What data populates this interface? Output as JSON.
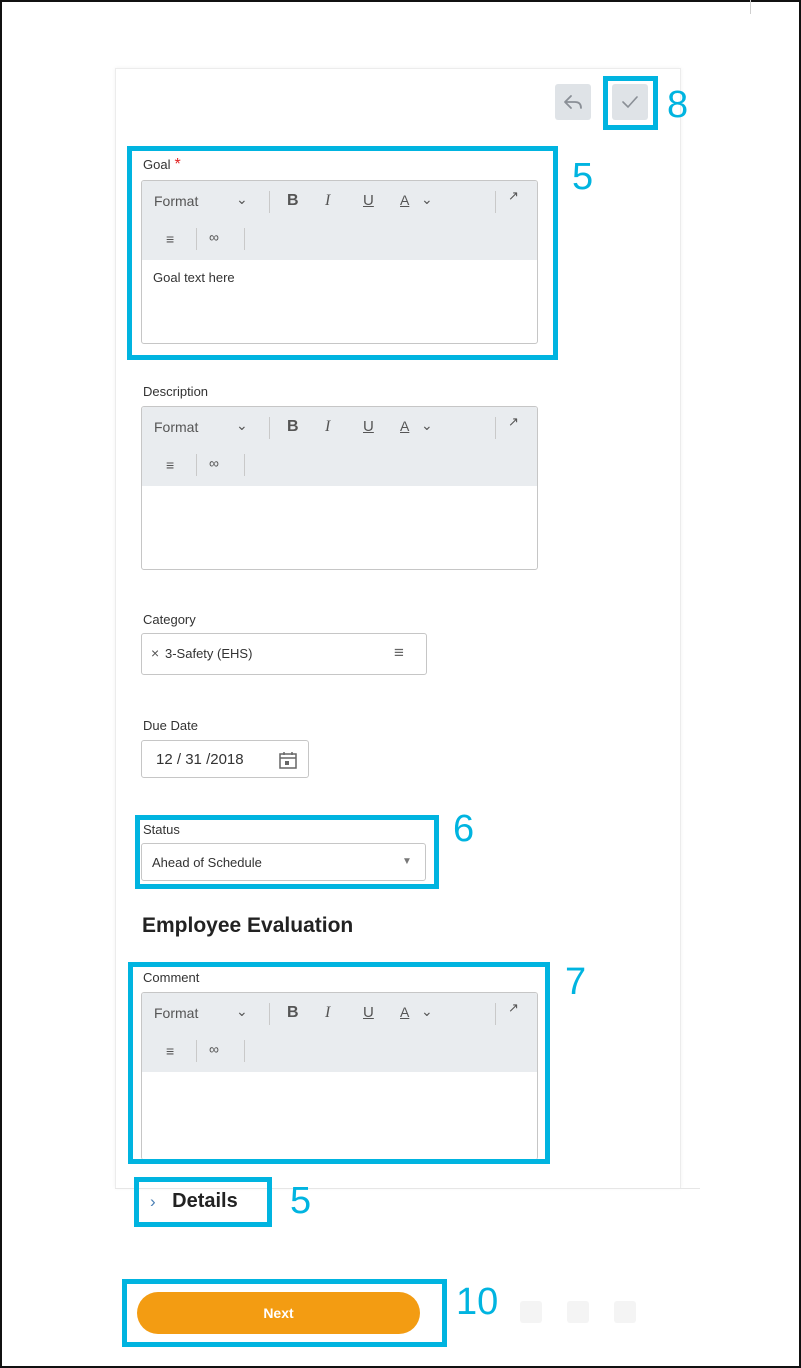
{
  "colors": {
    "highlight": "#00b4e0",
    "primary": "#f39c12",
    "required": "#e02020"
  },
  "header": {
    "cancel_icon": "reply-arrow-icon",
    "submit_icon": "check-icon"
  },
  "editor_toolbar": {
    "format": "Format",
    "bold": "B",
    "italic": "I",
    "underline": "U",
    "font_color": "A"
  },
  "goal": {
    "label": "Goal",
    "required_mark": "*",
    "value": "Goal text here"
  },
  "description": {
    "label": "Description",
    "value": ""
  },
  "category": {
    "label": "Category",
    "chip_remove": "×",
    "chip": "3-Safety (EHS)"
  },
  "due_date": {
    "label": "Due Date",
    "month": "12",
    "day": "31",
    "year": "2018",
    "sep": "/"
  },
  "status": {
    "label": "Status",
    "value": "Ahead of Schedule"
  },
  "evaluation": {
    "heading": "Employee Evaluation",
    "comment_label": "Comment",
    "comment_value": ""
  },
  "details": {
    "label": "Details"
  },
  "footer": {
    "next_label": "Next"
  },
  "callouts": {
    "goal": "5",
    "status": "6",
    "comment": "7",
    "submit": "8",
    "details": "5",
    "next": "10"
  }
}
